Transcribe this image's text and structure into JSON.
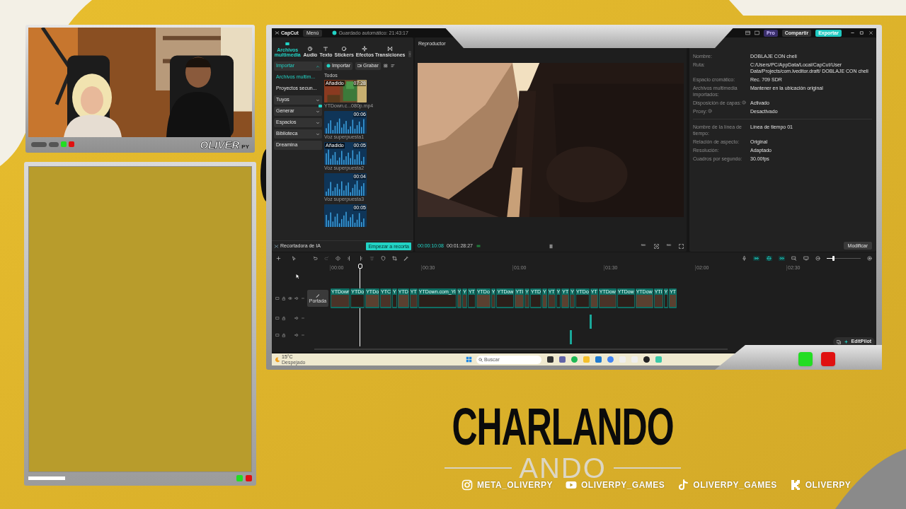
{
  "webcam": {
    "logo": "OLIVER",
    "logo_suffix": "PY"
  },
  "capcut": {
    "title_bar": {
      "app": "CapCut",
      "menu": "Menú",
      "autosave": "Guardado automático: 21:43:17",
      "buttons": [
        {
          "label": "Pro",
          "kind": "pro"
        },
        {
          "label": "Compartir",
          "kind": "plain"
        },
        {
          "label": "Exportar",
          "kind": "primary"
        }
      ]
    },
    "tool_tabs": [
      {
        "label": "Archivos multimedia",
        "selected": true
      },
      {
        "label": "Audio",
        "selected": false
      },
      {
        "label": "Texto",
        "selected": false
      },
      {
        "label": "Stickers",
        "selected": false
      },
      {
        "label": "Efectos",
        "selected": false
      },
      {
        "label": "Transiciones",
        "selected": false
      }
    ],
    "sidebar": [
      {
        "label": "Importar",
        "kind": "dropdown",
        "expanded": true
      },
      {
        "label": "Archivos multim...",
        "kind": "entry",
        "selected": true
      },
      {
        "label": "Proyectos secun...",
        "kind": "entry",
        "selected": false
      },
      {
        "label": "Tuyos",
        "kind": "dropdown",
        "expanded": false
      },
      {
        "label": "Generar",
        "kind": "dropdown",
        "expanded": false,
        "new_badge": true
      },
      {
        "label": "Espacios",
        "kind": "dropdown",
        "expanded": false
      },
      {
        "label": "Biblioteca",
        "kind": "dropdown",
        "expanded": false
      },
      {
        "label": "Dreamina",
        "kind": "button",
        "selected": false
      }
    ],
    "media_toolbar": {
      "import": "Importar",
      "record": "Grabar",
      "filter": "Todos"
    },
    "media": [
      {
        "kind": "video",
        "added": "Añadido",
        "duration": "07:28",
        "caption": "YTDown.c...080p.mp4"
      },
      {
        "kind": "audio",
        "duration": "00:06",
        "caption": "Voz superpuesta1"
      },
      {
        "kind": "audio",
        "added": "Añadido",
        "duration": "00:05",
        "caption": "Voz superpuesta2"
      },
      {
        "kind": "audio",
        "duration": "00:04",
        "caption": "Voz superpuesta3"
      },
      {
        "kind": "audio",
        "duration": "00:05"
      }
    ],
    "ai_cutter": {
      "label": "Recortadora de IA",
      "button": "Empezar a recorta"
    },
    "player": {
      "title": "Reproductor",
      "current": "00:00:10:08",
      "total": "00:01:28:27",
      "playing": true
    },
    "project_details": [
      {
        "label": "Nombre:",
        "value": "DOBLAJE CON cheli",
        "info": false
      },
      {
        "label": "Ruta:",
        "value": "C:/Users/PC/AppData/Local/CapCut/User Data/Projects/com.lveditor.draft/ DOBLAJE CON cheli",
        "info": false
      },
      {
        "label": "Espacio cromático:",
        "value": "Rec. 709 SDR",
        "info": false
      },
      {
        "label": "Archivos multimedia importados:",
        "value": "Mantener en la ubicación original",
        "info": false
      },
      {
        "label": "Disposición de capas:",
        "value": "Activado",
        "info": true
      },
      {
        "label": "Proxy:",
        "value": "Desactivado",
        "info": true
      }
    ],
    "timeline_details": [
      {
        "label": "Nombre de la línea de tiempo:",
        "value": "Línea de tiempo 01"
      },
      {
        "label": "Relación de aspecto:",
        "value": "Original"
      },
      {
        "label": "Resolución:",
        "value": "Adaptado"
      },
      {
        "label": "Cuadros por segundo:",
        "value": "30.00fps"
      }
    ],
    "modify_button": "Modificar",
    "timeline": {
      "ruler": [
        "00:00",
        "00:30",
        "01:00",
        "01:30",
        "02:00",
        "02:30"
      ],
      "cover": "Portada",
      "zoom": {
        "level": 0.2
      },
      "edit_pilot": "EditPilot",
      "clips": [
        "YTDowr",
        "YTDo",
        "YTDo",
        "YTC",
        "Y",
        "YTD",
        "YT",
        "YTDown.com_Yi",
        "Y",
        "Y",
        "YT",
        "YTDo",
        "Y",
        "YTDow",
        "YTI",
        "Y",
        "YTD",
        "Y",
        "YT",
        "Y",
        "YT",
        "Y",
        "YTDo",
        "YT",
        "YTDow",
        "YTDow",
        "YTDow",
        "YTI",
        "Y",
        "YT"
      ]
    },
    "taskbar": {
      "temperature": "15°C",
      "weather": "Despejado",
      "search_placeholder": "Buscar"
    }
  },
  "show": {
    "title": "CHARLANDO",
    "subtitle": "ANDO"
  },
  "socials": [
    {
      "kind": "instagram",
      "handle": "META_OLIVERPY"
    },
    {
      "kind": "youtube",
      "handle": "OLIVERPY_GAMES"
    },
    {
      "kind": "tiktok",
      "handle": "OLIVERPY_GAMES"
    },
    {
      "kind": "kick",
      "handle": "OLIVERPY"
    }
  ]
}
